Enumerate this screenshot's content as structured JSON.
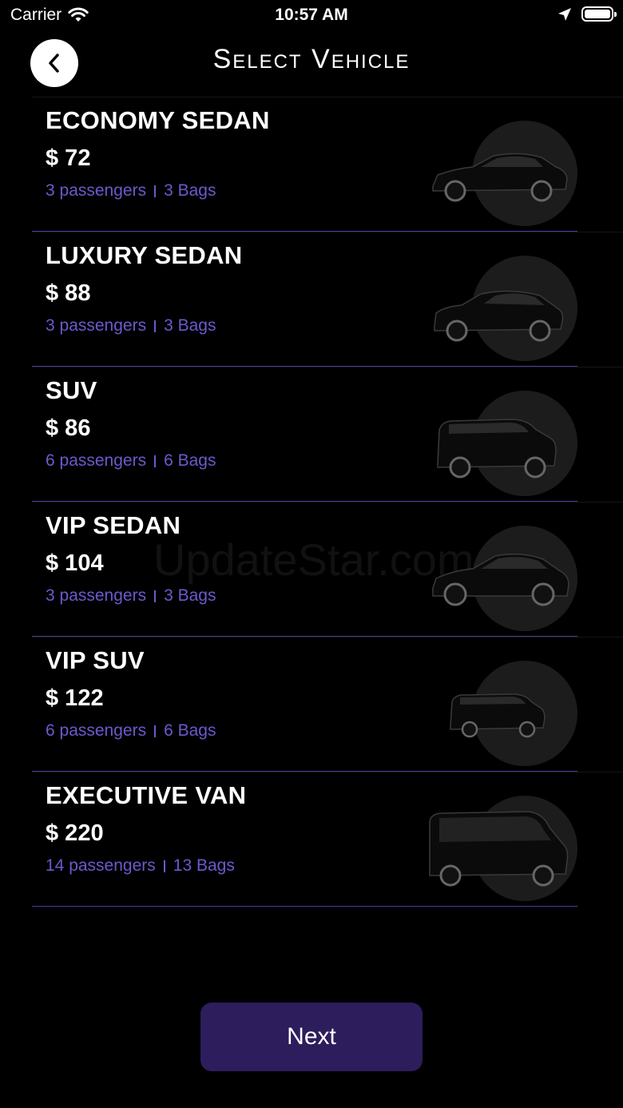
{
  "status_bar": {
    "carrier": "Carrier",
    "time": "10:57 AM"
  },
  "header": {
    "title": "Select Vehicle",
    "back_icon": "chevron-left-icon"
  },
  "vehicles": [
    {
      "name": "ECONOMY SEDAN",
      "price": "$ 72",
      "passengers": "3 passengers",
      "bags": "3 Bags",
      "icon": "sedan-car-icon"
    },
    {
      "name": "LUXURY SEDAN",
      "price": "$ 88",
      "passengers": "3 passengers",
      "bags": "3 Bags",
      "icon": "town-car-icon"
    },
    {
      "name": "SUV",
      "price": "$ 86",
      "passengers": "6 passengers",
      "bags": "6 Bags",
      "icon": "suv-icon"
    },
    {
      "name": "VIP SEDAN",
      "price": "$ 104",
      "passengers": "3 passengers",
      "bags": "3 Bags",
      "icon": "vip-sedan-icon"
    },
    {
      "name": "VIP SUV",
      "price": "$ 122",
      "passengers": "6 passengers",
      "bags": "6 Bags",
      "icon": "vip-suv-icon"
    },
    {
      "name": "EXECUTIVE VAN",
      "price": "$ 220",
      "passengers": "14 passengers",
      "bags": "13 Bags",
      "icon": "van-icon"
    }
  ],
  "footer": {
    "next_label": "Next"
  },
  "colors": {
    "accent": "#6a5acd",
    "divider": "#4b3e99",
    "button_bg": "#2d1d5c",
    "background": "#000000"
  }
}
